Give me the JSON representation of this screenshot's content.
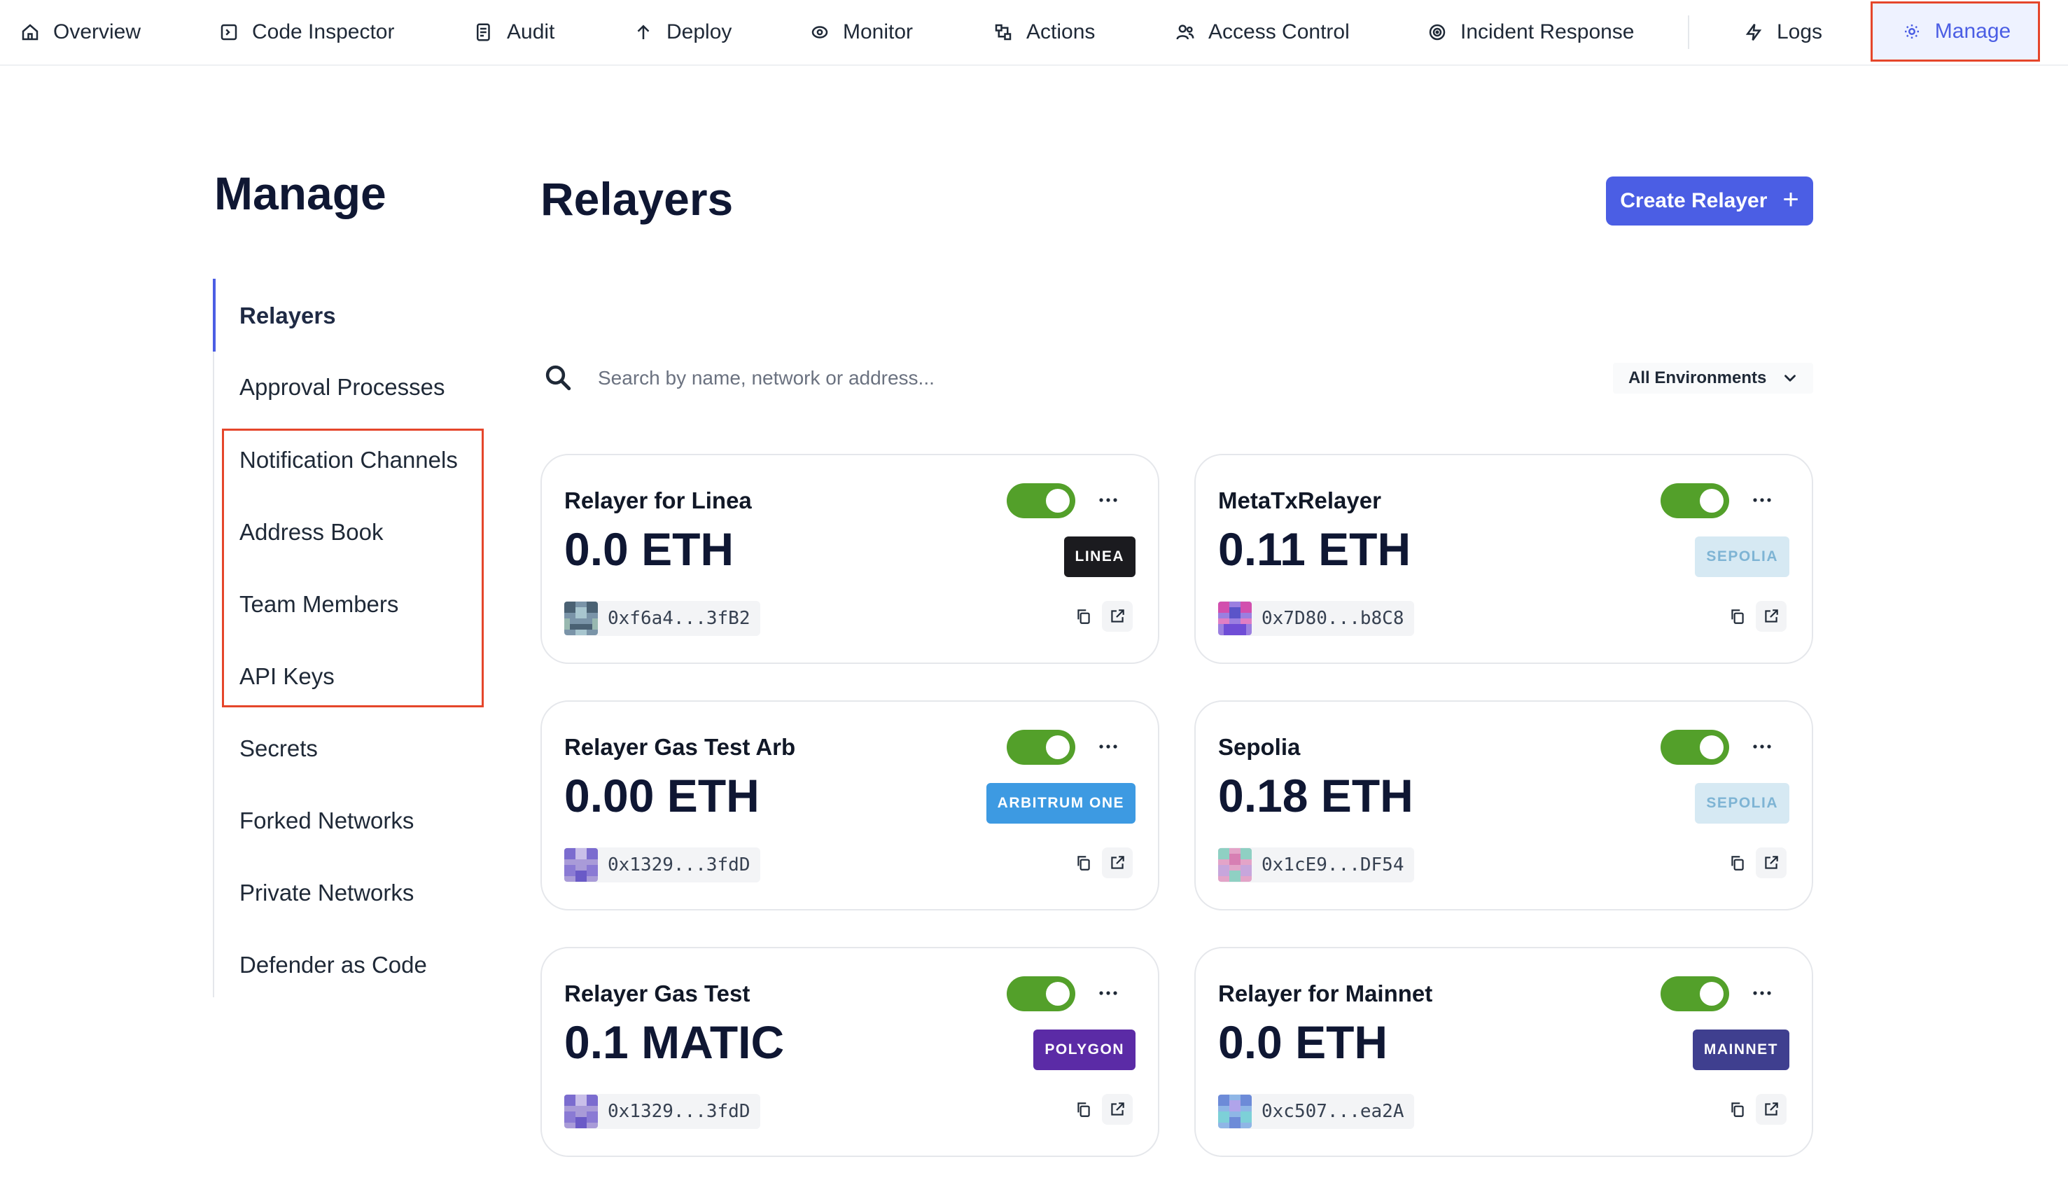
{
  "nav": {
    "items": [
      {
        "label": "Overview",
        "icon": "home-icon"
      },
      {
        "label": "Code Inspector",
        "icon": "code-icon"
      },
      {
        "label": "Audit",
        "icon": "audit-icon"
      },
      {
        "label": "Deploy",
        "icon": "arrow-up-icon"
      },
      {
        "label": "Monitor",
        "icon": "eye-icon"
      },
      {
        "label": "Actions",
        "icon": "actions-icon"
      },
      {
        "label": "Access Control",
        "icon": "users-icon"
      },
      {
        "label": "Incident Response",
        "icon": "target-icon"
      },
      {
        "label": "Logs",
        "icon": "bolt-icon"
      },
      {
        "label": "Manage",
        "icon": "gear-icon"
      }
    ],
    "active": "Manage"
  },
  "sidebar": {
    "title": "Manage",
    "items": [
      {
        "label": "Relayers",
        "active": true
      },
      {
        "label": "Approval Processes"
      },
      {
        "label": "Notification Channels"
      },
      {
        "label": "Address Book"
      },
      {
        "label": "Team Members"
      },
      {
        "label": "API Keys"
      },
      {
        "label": "Secrets"
      },
      {
        "label": "Forked Networks"
      },
      {
        "label": "Private Networks"
      },
      {
        "label": "Defender as Code"
      }
    ]
  },
  "main": {
    "title": "Relayers",
    "create_button": "Create Relayer",
    "search_placeholder": "Search by name, network or address...",
    "environment_filter": "All Environments"
  },
  "relayers": [
    {
      "name": "Relayer for Linea",
      "balance": "0.0 ETH",
      "network": "LINEA",
      "address": "0xf6a4...3fB2",
      "enabled": true
    },
    {
      "name": "MetaTxRelayer",
      "balance": "0.11 ETH",
      "network": "SEPOLIA",
      "address": "0x7D80...b8C8",
      "enabled": true
    },
    {
      "name": "Relayer Gas Test Arb",
      "balance": "0.00 ETH",
      "network": "ARBITRUM ONE",
      "address": "0x1329...3fdD",
      "enabled": true
    },
    {
      "name": "Sepolia",
      "balance": "0.18 ETH",
      "network": "SEPOLIA",
      "address": "0x1cE9...DF54",
      "enabled": true
    },
    {
      "name": "Relayer Gas Test",
      "balance": "0.1 MATIC",
      "network": "POLYGON",
      "address": "0x1329...3fdD",
      "enabled": true
    },
    {
      "name": "Relayer for Mainnet",
      "balance": "0.0 ETH",
      "network": "MAINNET",
      "address": "0xc507...ea2A",
      "enabled": true
    }
  ],
  "colors": {
    "accent": "#4b5ee4",
    "toggle_on": "#53a02a",
    "highlight": "#e5462b",
    "badge_linea": "#1b1b1f",
    "badge_sepolia_bg": "#d6e9f3",
    "badge_sepolia_text": "#7eb4d4",
    "badge_arbitrum": "#3d9ae2",
    "badge_polygon": "#5b2ba6",
    "badge_mainnet": "#3f3f8f"
  }
}
